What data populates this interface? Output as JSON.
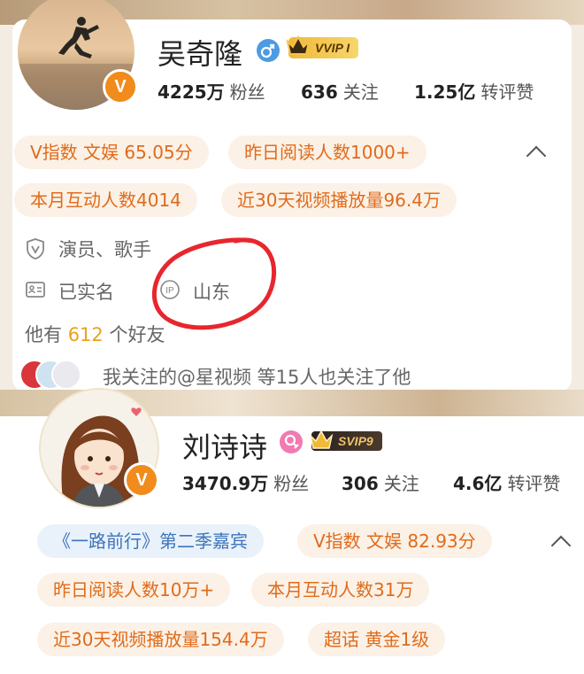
{
  "profile1": {
    "name": "吴奇隆",
    "vip_badge": "VVIP I",
    "stats": [
      {
        "value": "4225万",
        "label": "粉丝"
      },
      {
        "value": "636",
        "label": "关注"
      },
      {
        "value": "1.25亿",
        "label": "转评赞"
      }
    ],
    "tags_row1": [
      "V指数 文娱 65.05分",
      "昨日阅读人数1000+"
    ],
    "tags_row2": [
      "本月互动人数4014",
      "近30天视频播放量96.4万"
    ],
    "occupation": "演员、歌手",
    "verified": "已实名",
    "ip_location": "山东",
    "friends_prefix": "他有",
    "friends_count": "612",
    "friends_suffix": "个好友",
    "mutual_follow": "我关注的@星视频 等15人也关注了他"
  },
  "profile2": {
    "name": "刘诗诗",
    "vip_badge": "SVIP9",
    "stats": [
      {
        "value": "3470.9万",
        "label": "粉丝"
      },
      {
        "value": "306",
        "label": "关注"
      },
      {
        "value": "4.6亿",
        "label": "转评赞"
      }
    ],
    "tags_row1": [
      "《一路前行》第二季嘉宾",
      "V指数 文娱 82.93分"
    ],
    "tags_row2": [
      "昨日阅读人数10万+",
      "本月互动人数31万"
    ],
    "tags_row3": [
      "近30天视频播放量154.4万",
      "超话 黄金1级"
    ]
  },
  "colors": {
    "accent_orange": "#e06b1b",
    "tag_bg": "#fbf1e6",
    "blue_tag_text": "#3d74b8",
    "annotation_red": "#e8262d",
    "friends_count_color": "#e9a21a"
  }
}
